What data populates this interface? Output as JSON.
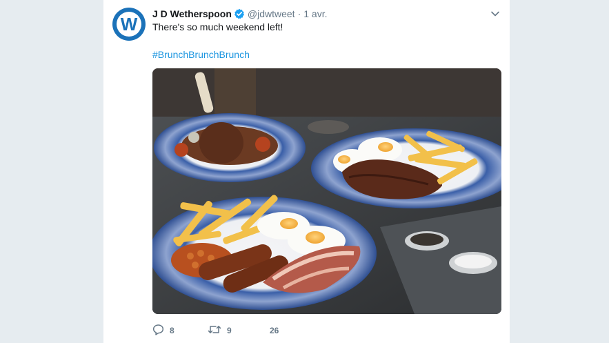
{
  "tweet": {
    "display_name": "J D Wetherspoon",
    "handle": "@jdwtweet",
    "separator": "·",
    "time": "1 avr.",
    "text": "There's so much weekend left!",
    "hashtag": "#BrunchBrunchBrunch",
    "avatar_letter": "W",
    "icons": [
      "verified-badge-icon",
      "chevron-down-icon",
      "reply-icon",
      "retweet-icon"
    ],
    "media": {
      "alt_subject": "brunch plates: full breakfast, steak with eggs and chips, lamb shank"
    },
    "actions": {
      "reply_count": "8",
      "retweet_count": "9",
      "like_count": "26"
    },
    "colors": {
      "brand_blue": "#1b72b9",
      "link_blue": "#1b95e0",
      "verified_blue": "#1da1f2",
      "muted": "#657786",
      "background": "#e6ecf0"
    }
  }
}
